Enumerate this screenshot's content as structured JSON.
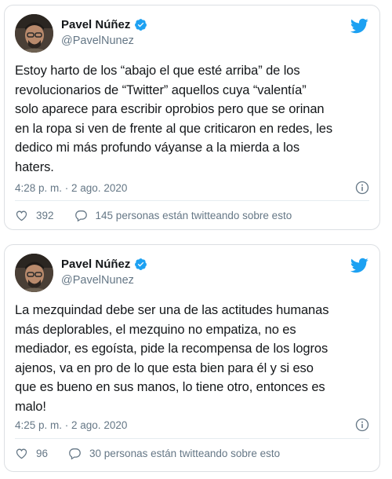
{
  "tweets": [
    {
      "name": "Pavel Núñez",
      "handle": "@PavelNunez",
      "text": "Estoy harto de los “abajo el que esté arriba” de los\nrevolucionarios de “Twitter” aquellos cuya “valentía”\nsolo aparece para escribir oprobios pero que se orinan\nen la ropa si ven de frente al que criticaron en redes, les\ndedico mi más profundo váyanse a la mierda a los\nhaters.",
      "timestamp": "4:28 p. m. · 2 ago. 2020",
      "likes": "392",
      "people_talking": "145 personas están twitteando sobre esto"
    },
    {
      "name": "Pavel Núñez",
      "handle": "@PavelNunez",
      "text": "La mezquindad debe ser una de las actitudes humanas\nmás deplorables, el mezquino no empatiza, no es\nmediador, es egoísta, pide la recompensa de los logros\najenos, va en pro de lo que esta bien para él y si eso\nque es bueno en sus manos, lo tiene otro, entonces es\nmalo!",
      "timestamp": "4:25 p. m. · 2 ago. 2020",
      "likes": "96",
      "people_talking": "30 personas están twitteando sobre esto"
    }
  ],
  "colors": {
    "twitter_blue": "#1da1f2",
    "text_primary": "#14171a",
    "text_secondary": "#657786",
    "border": "#dcdfe3"
  },
  "icons": [
    "twitter-bird-icon",
    "verified-badge-icon",
    "info-icon",
    "heart-icon",
    "reply-icon"
  ]
}
